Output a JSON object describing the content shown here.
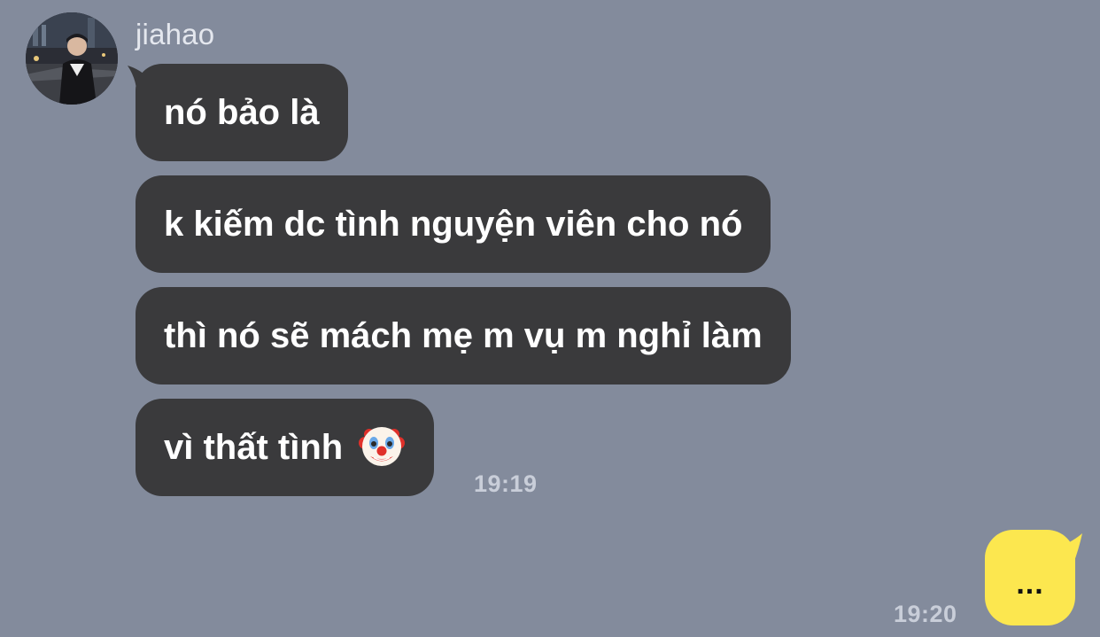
{
  "chat": {
    "contact_name": "jiahao",
    "messages": [
      {
        "text": "nó bảo là"
      },
      {
        "text": "k kiếm dc tình nguyện viên cho nó"
      },
      {
        "text": "thì nó sẽ mách mẹ m vụ m nghỉ làm"
      },
      {
        "text": "vì thất tình",
        "emoji": "clown-face-emoji"
      }
    ],
    "received_time": "19:19",
    "sent_message": {
      "text": "..."
    },
    "sent_time": "19:20"
  },
  "colors": {
    "background": "#838B9C",
    "received_bubble": "#3A3A3C",
    "sent_bubble": "#FCE74F"
  }
}
